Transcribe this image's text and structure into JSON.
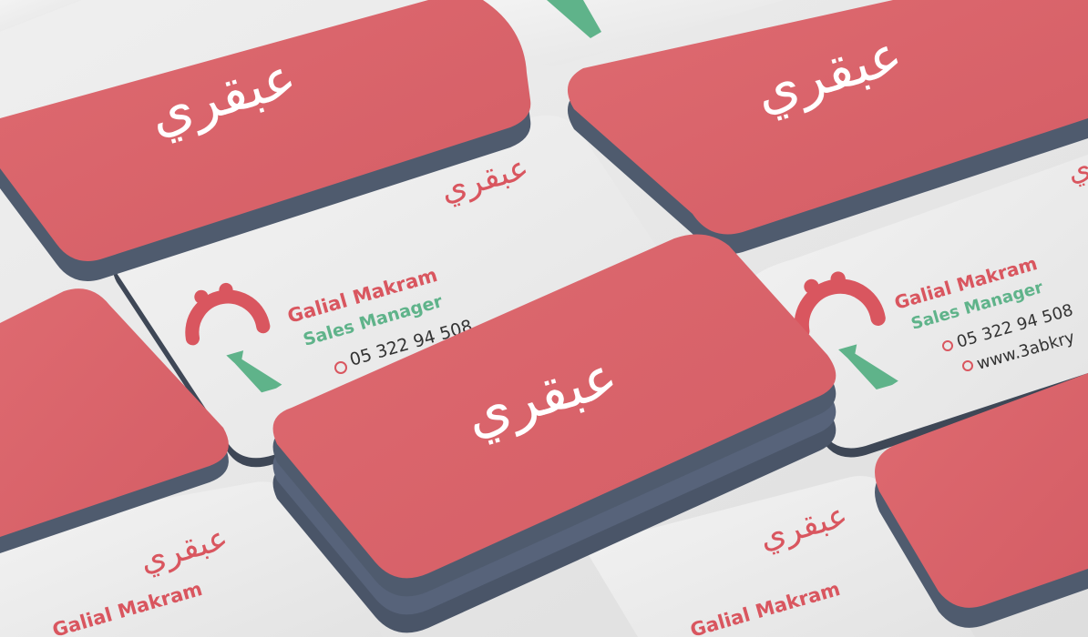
{
  "brand": {
    "logo_text": "عبقري",
    "colors": {
      "card_red": "#d9646b",
      "card_white": "#ececec",
      "stack_edge": "#4f5b6e",
      "accent_red": "#d9565f",
      "accent_green": "#5fb38a"
    }
  },
  "card_back": {
    "name": "Galial Makram",
    "title": "Sales Manager",
    "phone": "05 322 94 508",
    "website": "www.3abkry"
  },
  "icons": {
    "phone": "phone-icon",
    "globe": "globe-icon",
    "tie_logo": "tie-logo-icon"
  }
}
